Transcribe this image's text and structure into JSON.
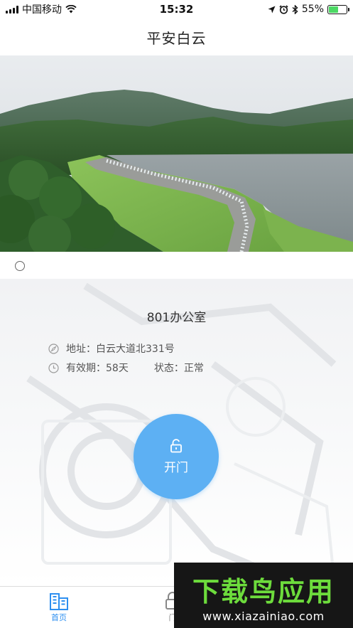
{
  "status_bar": {
    "carrier": "中国移动",
    "time": "15:32",
    "battery_text": "55%",
    "battery_level": 0.55,
    "icons": [
      "signal-icon",
      "wifi-icon",
      "location-icon",
      "alarm-icon",
      "bluetooth-icon",
      "battery-icon"
    ]
  },
  "nav": {
    "title": "平安白云"
  },
  "banner": {
    "page_count": 1,
    "active_index": 0
  },
  "door": {
    "room_name": "801办公室",
    "address_label": "地址：",
    "address": "白云大道北331号",
    "validity_label": "有效期：",
    "validity": "58天",
    "status_label": "状态：",
    "status": "正常",
    "open_label": "开门"
  },
  "tab_bar": {
    "tabs": [
      {
        "label": "首页",
        "icon": "building-icon",
        "active": true
      },
      {
        "label": "门",
        "icon": "lock-icon",
        "active": false
      }
    ]
  },
  "watermark": {
    "title": "下载鸟应用",
    "url": "www.xiazainiao.com"
  },
  "colors": {
    "accent": "#5db0f3",
    "tab_active": "#2d8ff0",
    "watermark_green": "#6ddc3c"
  }
}
